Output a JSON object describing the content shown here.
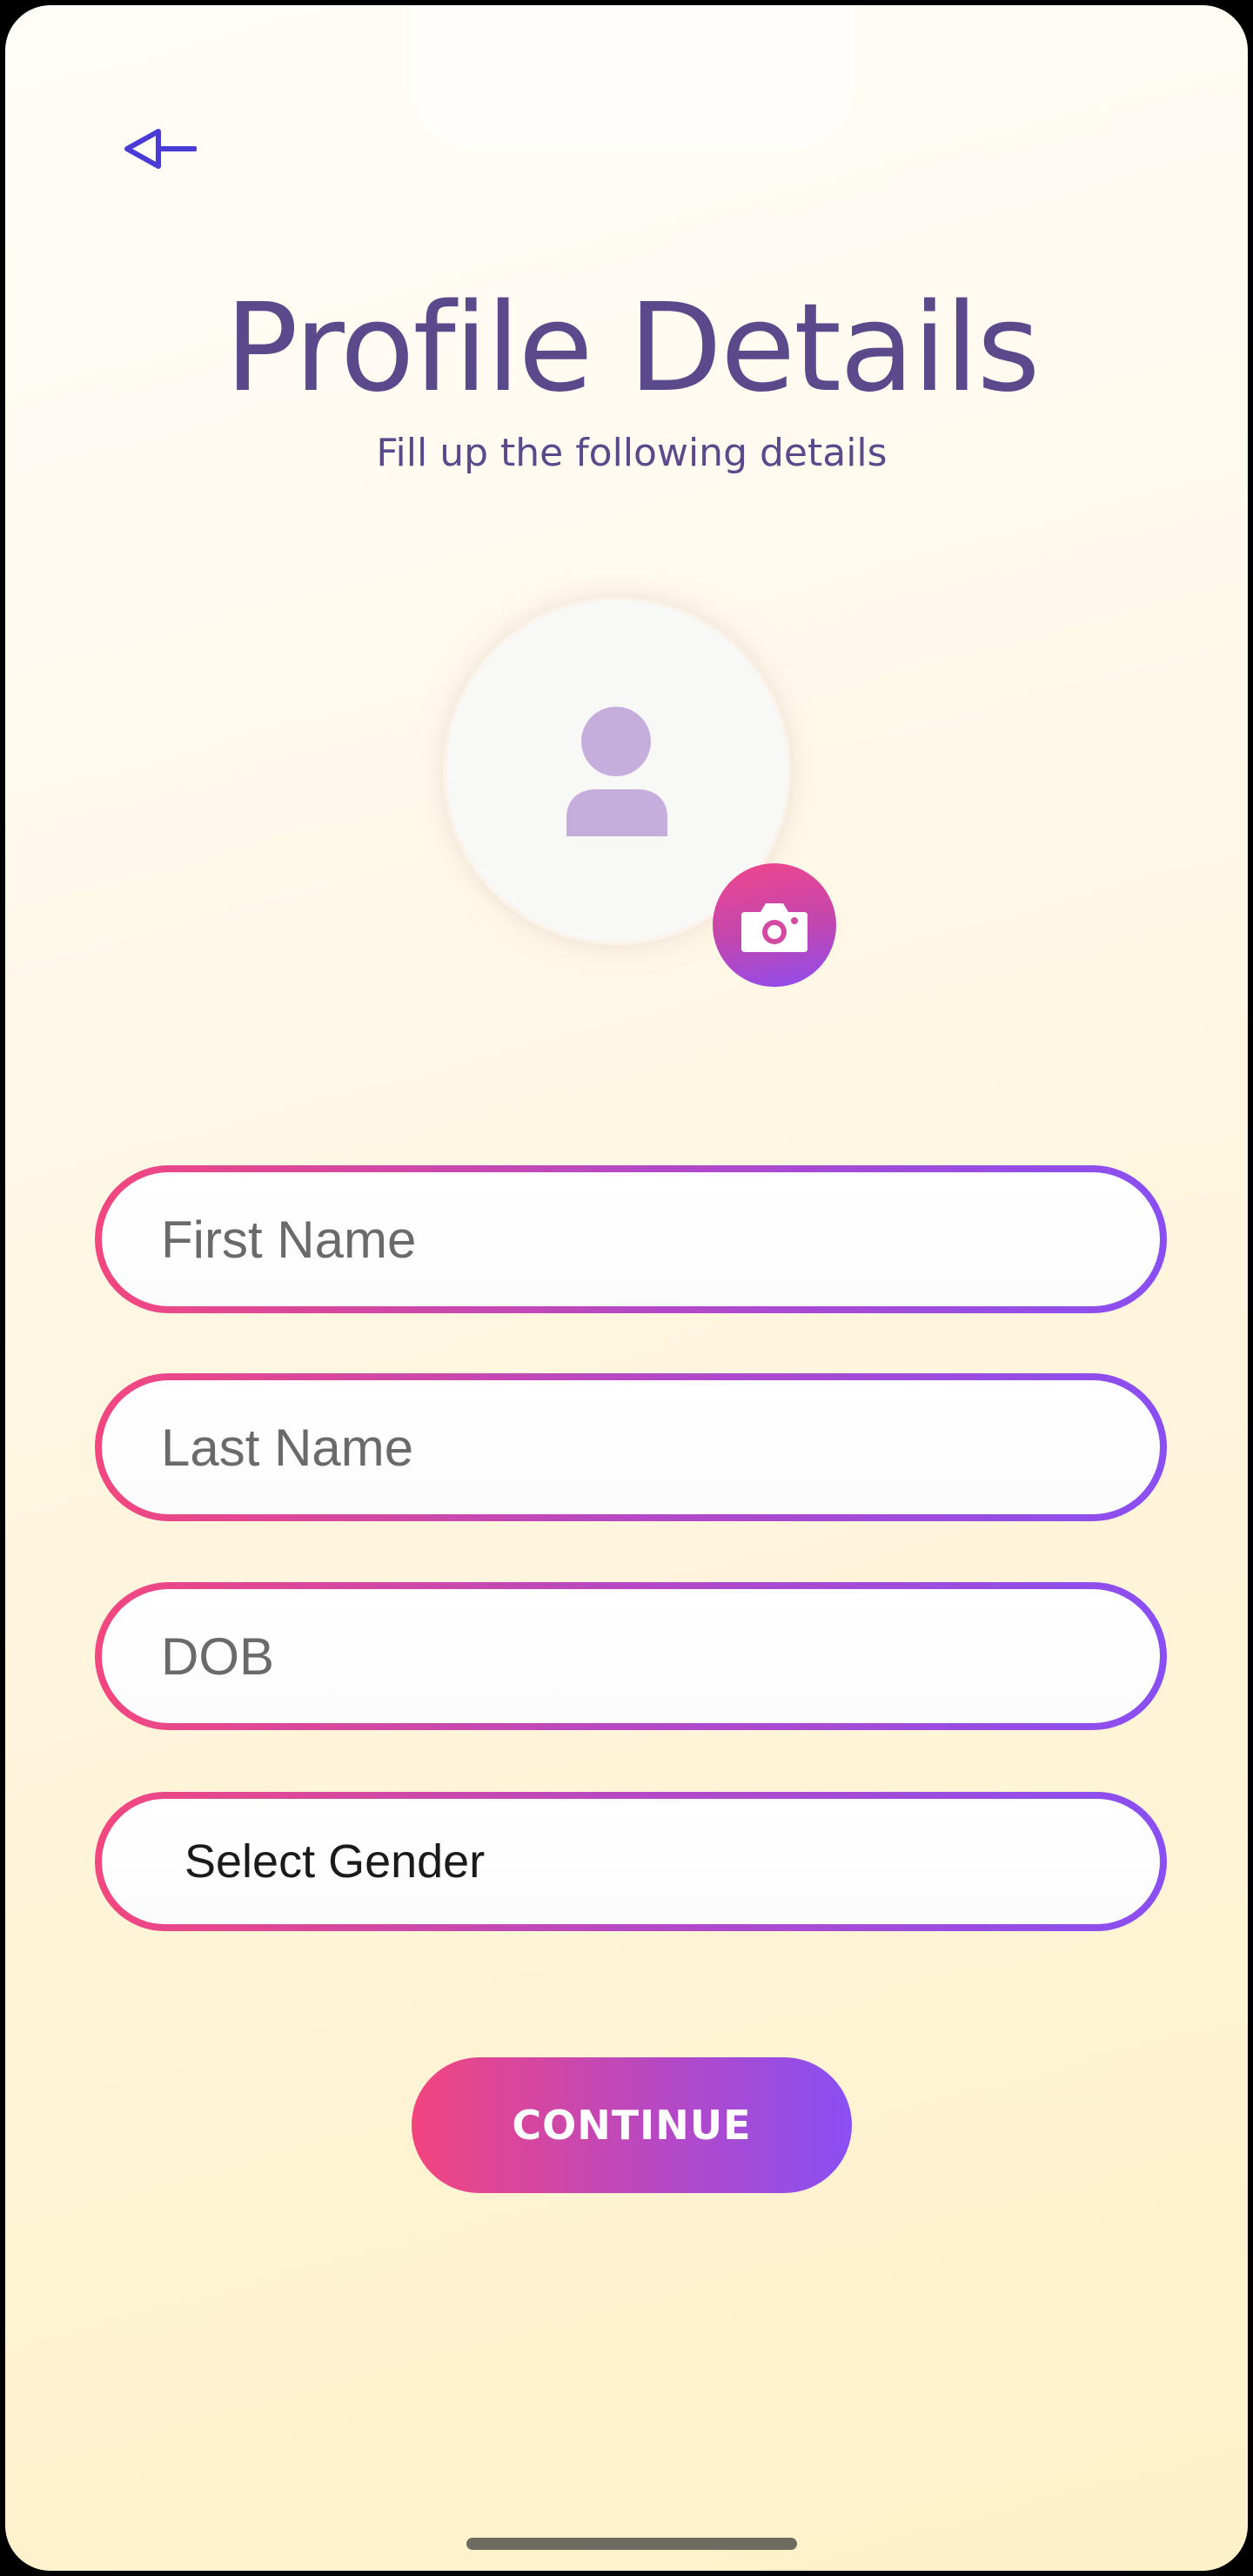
{
  "header": {
    "back_icon": "back-arrow-icon",
    "title": "Profile Details",
    "subtitle": "Fill up the following details"
  },
  "avatar": {
    "icon": "person-icon",
    "camera_icon": "camera-icon",
    "colors": {
      "person": "#c6aedc",
      "camera_gradient_start": "#f0458c",
      "camera_gradient_end": "#8e4cf0"
    }
  },
  "form": {
    "first_name_placeholder": "First Name",
    "last_name_placeholder": "Last Name",
    "dob_placeholder": "DOB",
    "gender_value": "Select Gender"
  },
  "actions": {
    "continue_label": "CONTINUE"
  },
  "theme": {
    "title_color": "#5a4a8c",
    "accent_start": "#f2477f",
    "accent_end": "#8a4ff2",
    "back_arrow": "#4a3bd6"
  }
}
